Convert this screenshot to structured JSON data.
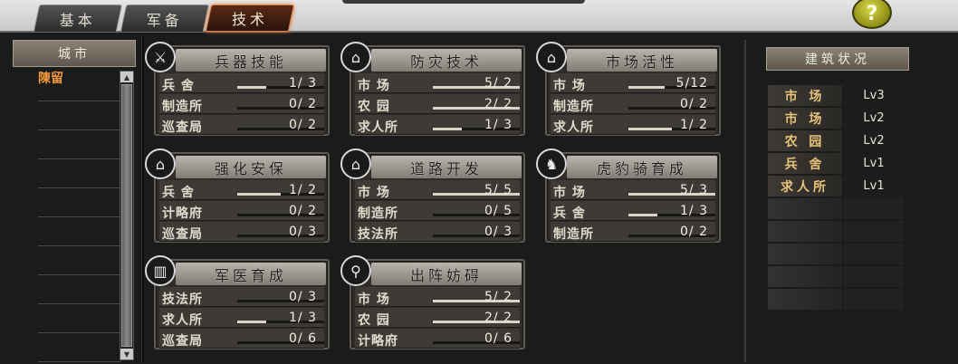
{
  "tabs": [
    {
      "label": "基本",
      "active": false
    },
    {
      "label": "军备",
      "active": false
    },
    {
      "label": "技术",
      "active": true
    }
  ],
  "help": {
    "label": "?"
  },
  "city_panel": {
    "header": "城市",
    "cities": [
      "陳留",
      "",
      "",
      "",
      "",
      "",
      "",
      "",
      "",
      ""
    ]
  },
  "techs": [
    {
      "title": "兵器技能",
      "icon": "sword-icon",
      "rows": [
        {
          "label": "兵 舍",
          "value": "1/ 3",
          "fill": 0.33
        },
        {
          "label": "制造所",
          "value": "0/ 2",
          "fill": 0
        },
        {
          "label": "巡查局",
          "value": "0/ 2",
          "fill": 0
        }
      ]
    },
    {
      "title": "防灾技术",
      "icon": "building-upgrade-icon",
      "rows": [
        {
          "label": "市 场",
          "value": "5/ 2",
          "fill": 1
        },
        {
          "label": "农 园",
          "value": "2/ 2",
          "fill": 1
        },
        {
          "label": "求人所",
          "value": "1/ 3",
          "fill": 0.33
        }
      ]
    },
    {
      "title": "市场活性",
      "icon": "building-upgrade-icon",
      "rows": [
        {
          "label": "市 场",
          "value": "5/12",
          "fill": 0.42
        },
        {
          "label": "制造所",
          "value": "0/ 2",
          "fill": 0
        },
        {
          "label": "求人所",
          "value": "1/ 2",
          "fill": 0.5
        }
      ]
    },
    {
      "title": "强化安保",
      "icon": "building-upgrade-icon",
      "rows": [
        {
          "label": "兵 舍",
          "value": "1/ 2",
          "fill": 0.5
        },
        {
          "label": "计略府",
          "value": "0/ 2",
          "fill": 0
        },
        {
          "label": "巡查局",
          "value": "0/ 3",
          "fill": 0
        }
      ]
    },
    {
      "title": "道路开发",
      "icon": "building-upgrade-icon",
      "rows": [
        {
          "label": "市 场",
          "value": "5/ 5",
          "fill": 1
        },
        {
          "label": "制造所",
          "value": "0/ 5",
          "fill": 0
        },
        {
          "label": "技法所",
          "value": "0/ 3",
          "fill": 0
        }
      ]
    },
    {
      "title": "虎豹骑育成",
      "icon": "horse-icon",
      "rows": [
        {
          "label": "市 场",
          "value": "5/ 3",
          "fill": 1
        },
        {
          "label": "兵 舍",
          "value": "1/ 3",
          "fill": 0.33
        },
        {
          "label": "制造所",
          "value": "0/ 2",
          "fill": 0
        }
      ]
    },
    {
      "title": "军医育成",
      "icon": "barracks-icon",
      "rows": [
        {
          "label": "技法所",
          "value": "0/ 3",
          "fill": 0
        },
        {
          "label": "求人所",
          "value": "1/ 3",
          "fill": 0.33
        },
        {
          "label": "巡查局",
          "value": "0/ 6",
          "fill": 0
        }
      ]
    },
    {
      "title": "出阵妨碍",
      "icon": "search-weapon-icon",
      "rows": [
        {
          "label": "市 场",
          "value": "5/ 2",
          "fill": 1
        },
        {
          "label": "农 园",
          "value": "2/ 2",
          "fill": 1
        },
        {
          "label": "计略府",
          "value": "0/ 6",
          "fill": 0
        }
      ]
    }
  ],
  "buildings": {
    "header": "建筑状况",
    "items": [
      {
        "name": "市 场",
        "level": "Lv3"
      },
      {
        "name": "市 场",
        "level": "Lv2"
      },
      {
        "name": "农 园",
        "level": "Lv2"
      },
      {
        "name": "兵 舍",
        "level": "Lv1"
      },
      {
        "name": "求人所",
        "level": "Lv1"
      },
      {
        "name": "",
        "level": ""
      },
      {
        "name": "",
        "level": ""
      },
      {
        "name": "",
        "level": ""
      },
      {
        "name": "",
        "level": ""
      },
      {
        "name": "",
        "level": ""
      }
    ]
  }
}
